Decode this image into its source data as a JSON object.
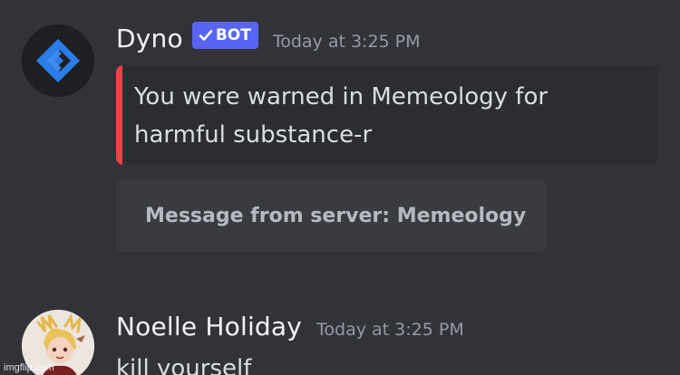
{
  "messages": [
    {
      "author": "Dyno",
      "bot_tag": "BOT",
      "timestamp": "Today at 3:25 PM",
      "embed": {
        "text": "You were warned in Memeology for harmful substance-r",
        "accent_color": "#ed4245"
      },
      "server_chip": "Message from server: Memeology",
      "avatar_icon": "dyno-logo-icon"
    },
    {
      "author": "Noelle Holiday",
      "timestamp": "Today at 3:25 PM",
      "text": "kill yourself",
      "avatar_icon": "user-avatar-image"
    }
  ],
  "watermark": "imgflip.com",
  "colors": {
    "background": "#313338",
    "embed_background": "#2b2d31",
    "bot_tag": "#5865f2",
    "embed_accent": "#ed4245",
    "dyno_logo": "#2b7de9"
  }
}
